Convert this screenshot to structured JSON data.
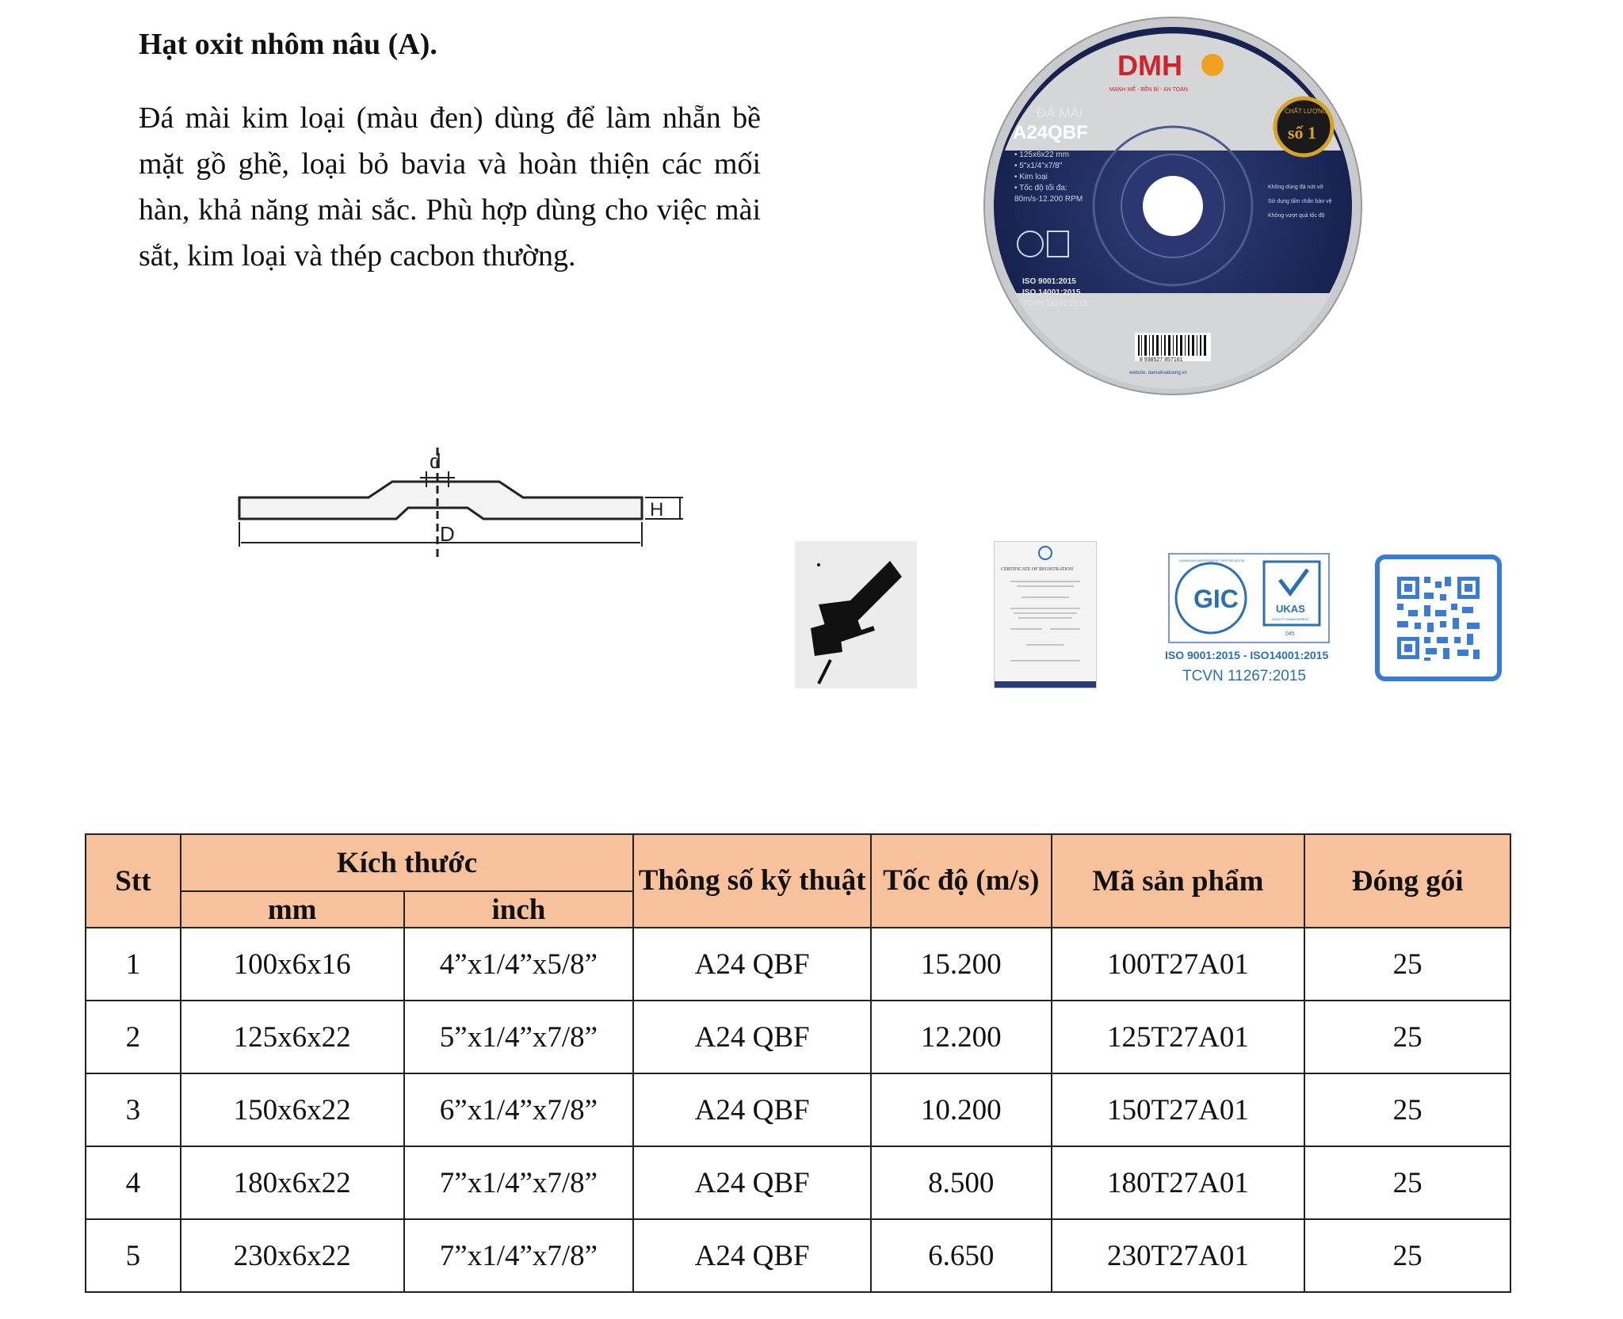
{
  "heading": "Hạt oxit nhôm nâu (A).",
  "description": "Đá mài kim loại (màu đen) dùng để làm nhẵn bề mặt gồ ghề, loại bỏ bavia và hoàn thiện các mối hàn, khả năng mài sắc. Phù hợp dùng cho việc mài sắt, kim loại và thép cacbon thường.",
  "product_label": {
    "brand": "DMH",
    "brand_small": "MẠNH MẼ - BỀN BỈ - AN TOÀN",
    "type": "ĐÁ MÀI",
    "model": "A24QBF",
    "specs": [
      "• 125x6x22 mm",
      "• 5\"x1/4\"x7/8\"",
      "• Kim loại",
      "• Tốc độ tối đa:",
      "80m/s-12.200 RPM"
    ],
    "badge_top": "CHẤT LƯỢNG",
    "badge_main": "số 1",
    "warnings": [
      "Không dùng đá nứt vỡ",
      "Sử dụng tấm chắn bảo vệ",
      "Không vượt quá tốc độ"
    ],
    "certs": [
      "ISO 9001:2015",
      "ISO 14001:2015",
      "TCVN 11267:2015"
    ],
    "origin": "SX tại Việt Nam",
    "barcode": "8 938527 857161",
    "website": "website: damaihaiduong.vn"
  },
  "diagram": {
    "label_d": "d",
    "label_D": "D",
    "label_H": "H"
  },
  "iso_block": {
    "gic": "GIC",
    "ring_text": "GUARDIAN INDEPENDENT CERTIFICATION",
    "ukas": "UKAS",
    "ukas_sub": "QUALITY MANAGEMENT",
    "ukas_num": "045",
    "line1": "ISO 9001:2015 - ISO14001:2015",
    "line2": "TCVN 11267:2015"
  },
  "certificate_doc": {
    "title": "CERTIFICATE OF REGISTRATION"
  },
  "colors": {
    "header_bg": "#f7c19c",
    "disc_blue": "#1f2d63",
    "brand_red": "#d2232a",
    "qr_blue": "#3a7bd5",
    "iso_blue": "#2a6fb5"
  },
  "table": {
    "headers": {
      "stt": "Stt",
      "size": "Kích thước",
      "mm": "mm",
      "inch": "inch",
      "spec": "Thông số kỹ thuật",
      "speed": "Tốc độ (m/s)",
      "code": "Mã sản phẩm",
      "pack": "Đóng gói"
    },
    "rows": [
      {
        "stt": "1",
        "mm": "100x6x16",
        "inch": "4”x1/4”x5/8”",
        "spec": "A24 QBF",
        "speed": "15.200",
        "code": "100T27A01",
        "pack": "25"
      },
      {
        "stt": "2",
        "mm": "125x6x22",
        "inch": "5”x1/4”x7/8”",
        "spec": "A24 QBF",
        "speed": "12.200",
        "code": "125T27A01",
        "pack": "25"
      },
      {
        "stt": "3",
        "mm": "150x6x22",
        "inch": "6”x1/4”x7/8”",
        "spec": "A24 QBF",
        "speed": "10.200",
        "code": "150T27A01",
        "pack": "25"
      },
      {
        "stt": "4",
        "mm": "180x6x22",
        "inch": "7”x1/4”x7/8”",
        "spec": "A24 QBF",
        "speed": "8.500",
        "code": "180T27A01",
        "pack": "25"
      },
      {
        "stt": "5",
        "mm": "230x6x22",
        "inch": "7”x1/4”x7/8”",
        "spec": "A24 QBF",
        "speed": "6.650",
        "code": "230T27A01",
        "pack": "25"
      }
    ]
  }
}
